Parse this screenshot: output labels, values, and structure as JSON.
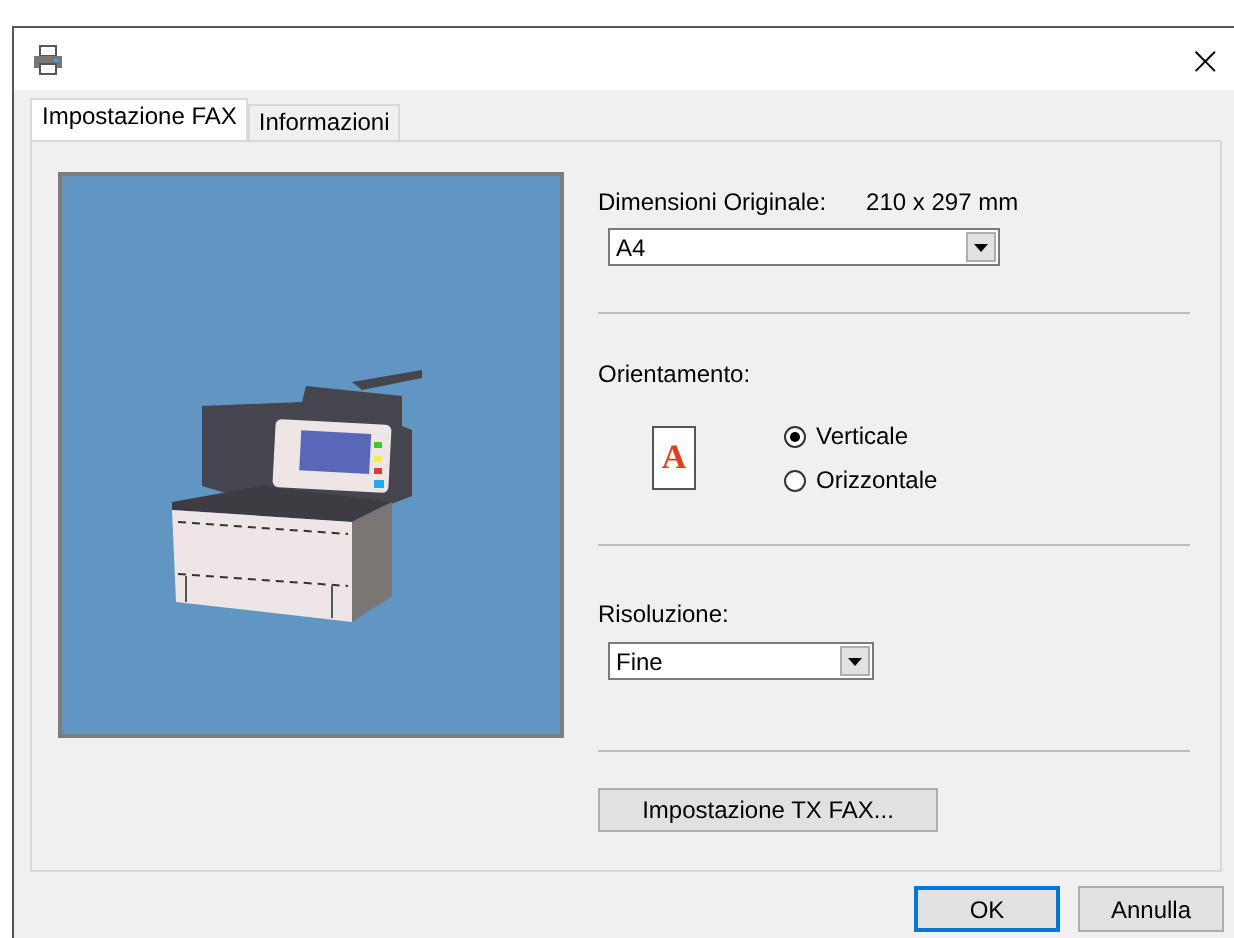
{
  "window": {
    "close": "×"
  },
  "tabs": [
    {
      "label": "Impostazione FAX",
      "selected": true
    },
    {
      "label": "Informazioni",
      "selected": false
    }
  ],
  "original_size": {
    "label": "Dimensioni Originale:",
    "value": "210 x 297 mm",
    "select": "A4"
  },
  "orientation": {
    "label": "Orientamento:",
    "icon_letter": "A",
    "options": [
      {
        "label": "Verticale",
        "selected": true
      },
      {
        "label": "Orizzontale",
        "selected": false
      }
    ]
  },
  "resolution": {
    "label": "Risoluzione:",
    "select": "Fine"
  },
  "tx_button": "Impostazione TX FAX...",
  "buttons": [
    {
      "label": "OK",
      "default": true
    },
    {
      "label": "Annulla",
      "default": false
    }
  ]
}
